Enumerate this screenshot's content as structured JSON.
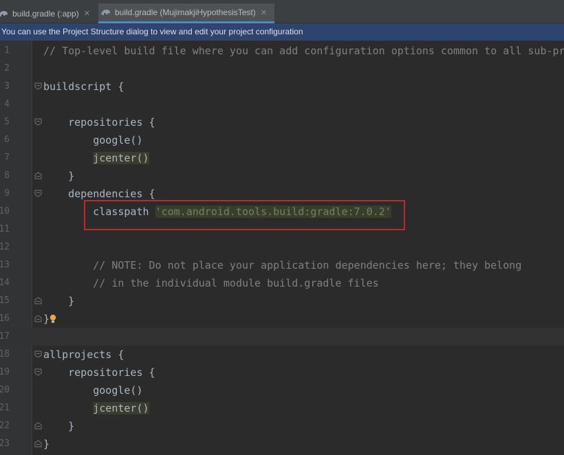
{
  "tabs": [
    {
      "label": "build.gradle (:app)",
      "active": false
    },
    {
      "label": "build.gradle (MujimakjiHypothesisTest)",
      "active": true
    }
  ],
  "banner": {
    "text": "You can use the Project Structure dialog to view and edit your project configuration"
  },
  "editor": {
    "current_line": 17,
    "lines": [
      {
        "n": "1",
        "comment": "// Top-level build file where you can add configuration options common to all sub-pr"
      },
      {
        "n": "2"
      },
      {
        "n": "3",
        "text": "buildscript {"
      },
      {
        "n": "4"
      },
      {
        "n": "5",
        "text": "    repositories {"
      },
      {
        "n": "6",
        "text": "        google()"
      },
      {
        "n": "7",
        "indent": "        ",
        "fn": "jcenter()"
      },
      {
        "n": "8",
        "text": "    }"
      },
      {
        "n": "9",
        "text": "    dependencies {"
      },
      {
        "n": "10",
        "text": "        classpath ",
        "string": "'com.android.tools.build:gradle:7.0.2'"
      },
      {
        "n": "11"
      },
      {
        "n": "12"
      },
      {
        "n": "13",
        "comment": "        // NOTE: Do not place your application dependencies here; they belong"
      },
      {
        "n": "14",
        "comment": "        // in the individual module build.gradle files"
      },
      {
        "n": "15",
        "text": "    }"
      },
      {
        "n": "16",
        "text": "}"
      },
      {
        "n": "17"
      },
      {
        "n": "18",
        "text": "allprojects {"
      },
      {
        "n": "19",
        "text": "    repositories {"
      },
      {
        "n": "20",
        "text": "        google()"
      },
      {
        "n": "21",
        "indent": "        ",
        "fn": "jcenter()"
      },
      {
        "n": "22",
        "text": "    }"
      },
      {
        "n": "23",
        "text": "}"
      }
    ]
  },
  "colors": {
    "keyword_text": "#a9b7c6",
    "comment": "#808080",
    "string": "#6a8759",
    "banner_bg": "#2e436e",
    "annotation_box": "#c0282a"
  }
}
